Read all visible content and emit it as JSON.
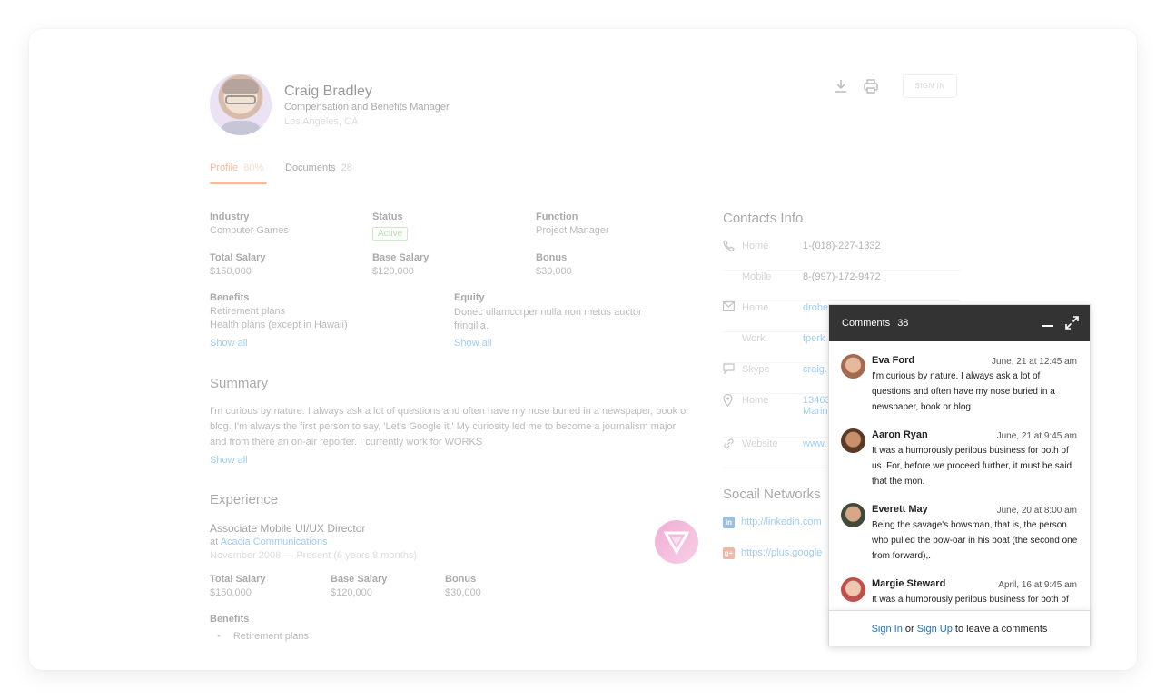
{
  "profile": {
    "name": "Craig Bradley",
    "title": "Compensation and Benefits Manager",
    "location": "Los Angeles, CA"
  },
  "toolbar": {
    "download_icon": "download-icon",
    "print_icon": "print-icon",
    "sign_in_label": "SIGN IN"
  },
  "tabs": [
    {
      "label": "Profile",
      "count": "80%"
    },
    {
      "label": "Documents",
      "count": "28"
    }
  ],
  "details": {
    "industry": {
      "label": "Industry",
      "value": "Computer Games"
    },
    "status": {
      "label": "Status",
      "value": "Active"
    },
    "function": {
      "label": "Function",
      "value": "Project Manager"
    },
    "total_salary": {
      "label": "Total Salary",
      "value": "$150,000"
    },
    "base_salary": {
      "label": "Base Salary",
      "value": "$120,000"
    },
    "bonus": {
      "label": "Bonus",
      "value": "$30,000"
    },
    "benefits": {
      "label": "Benefits",
      "line1": "Retirement plans",
      "line2": "Health plans (except in Hawaii)",
      "show_all": "Show all"
    },
    "equity": {
      "label": "Equity",
      "value": "Donec ullamcorper nulla non metus auctor fringilla.",
      "show_all": "Show all"
    }
  },
  "summary": {
    "heading": "Summary",
    "text": "I'm curious by nature. I always ask a lot of questions and often have my nose buried in a newspaper, book or blog. I'm always the first person to say, 'Let's Google it.' My curiosity led me to become a journalism major and from there an on-air reporter. I currently work for WORKS",
    "show_all": "Show all"
  },
  "experience": {
    "heading": "Experience",
    "job_title": "Associate Mobile UI/UX Director",
    "at": "at",
    "company": "Acacia Communications",
    "period": "November 2008 — Present (6 years 8 months)",
    "total_salary": {
      "label": "Total Salary",
      "value": "$150,000"
    },
    "base_salary": {
      "label": "Base Salary",
      "value": "$120,000"
    },
    "bonus": {
      "label": "Bonus",
      "value": "$30,000"
    },
    "benefits_label": "Benefits",
    "benefits_item": "Retirement plans"
  },
  "contacts": {
    "heading": "Contacts Info",
    "rows": [
      {
        "icon": "phone-icon",
        "label": "Home",
        "value": "1-(018)-227-1332"
      },
      {
        "icon": "",
        "label": "Mobile",
        "value": "8-(997)-172-9472"
      },
      {
        "icon": "mail-icon",
        "label": "Home",
        "value": "drobe"
      },
      {
        "icon": "",
        "label": "Work",
        "value": "fperk"
      },
      {
        "icon": "chat-icon",
        "label": "Skype",
        "value": "craig."
      },
      {
        "icon": "pin-icon",
        "label": "Home",
        "value": "13463",
        "value2": "Marin"
      },
      {
        "icon": "link-icon",
        "label": "Website",
        "value": "www."
      }
    ]
  },
  "social": {
    "heading": "Socail Networks",
    "items": [
      {
        "icon": "linkedin-icon",
        "url": "http://linkedin.com"
      },
      {
        "icon": "google-plus-icon",
        "url": "https://plus.google"
      }
    ]
  },
  "comments": {
    "title": "Comments",
    "count": "38",
    "items": [
      {
        "name": "Eva Ford",
        "time": "June, 21 at 12:45 am",
        "text": "I'm curious by nature. I always ask a lot of questions and often have my nose buried in a newspaper, book or blog.",
        "color": "#a36a4f"
      },
      {
        "name": "Aaron Ryan",
        "time": "June, 21 at 9:45 am",
        "text": "It was a humorously perilous business for both of us. For, before we proceed further, it must be said that the mon.",
        "color": "#5a3a26"
      },
      {
        "name": "Everett May",
        "time": "June, 20 at 8:00 am",
        "text": "Being the savage's bowsman, that is, the person who pulled the bow-oar in his boat (the second one from forward),.",
        "color": "#3f4a3a"
      },
      {
        "name": "Margie Steward",
        "time": "April, 16 at 9:45 am",
        "text": "It was a humorously perilous business for both of",
        "color": "#c0504d"
      }
    ],
    "footer": {
      "sign_in": "Sign In",
      "or": "or",
      "sign_up": "Sign Up",
      "rest": "to leave a comments"
    }
  }
}
